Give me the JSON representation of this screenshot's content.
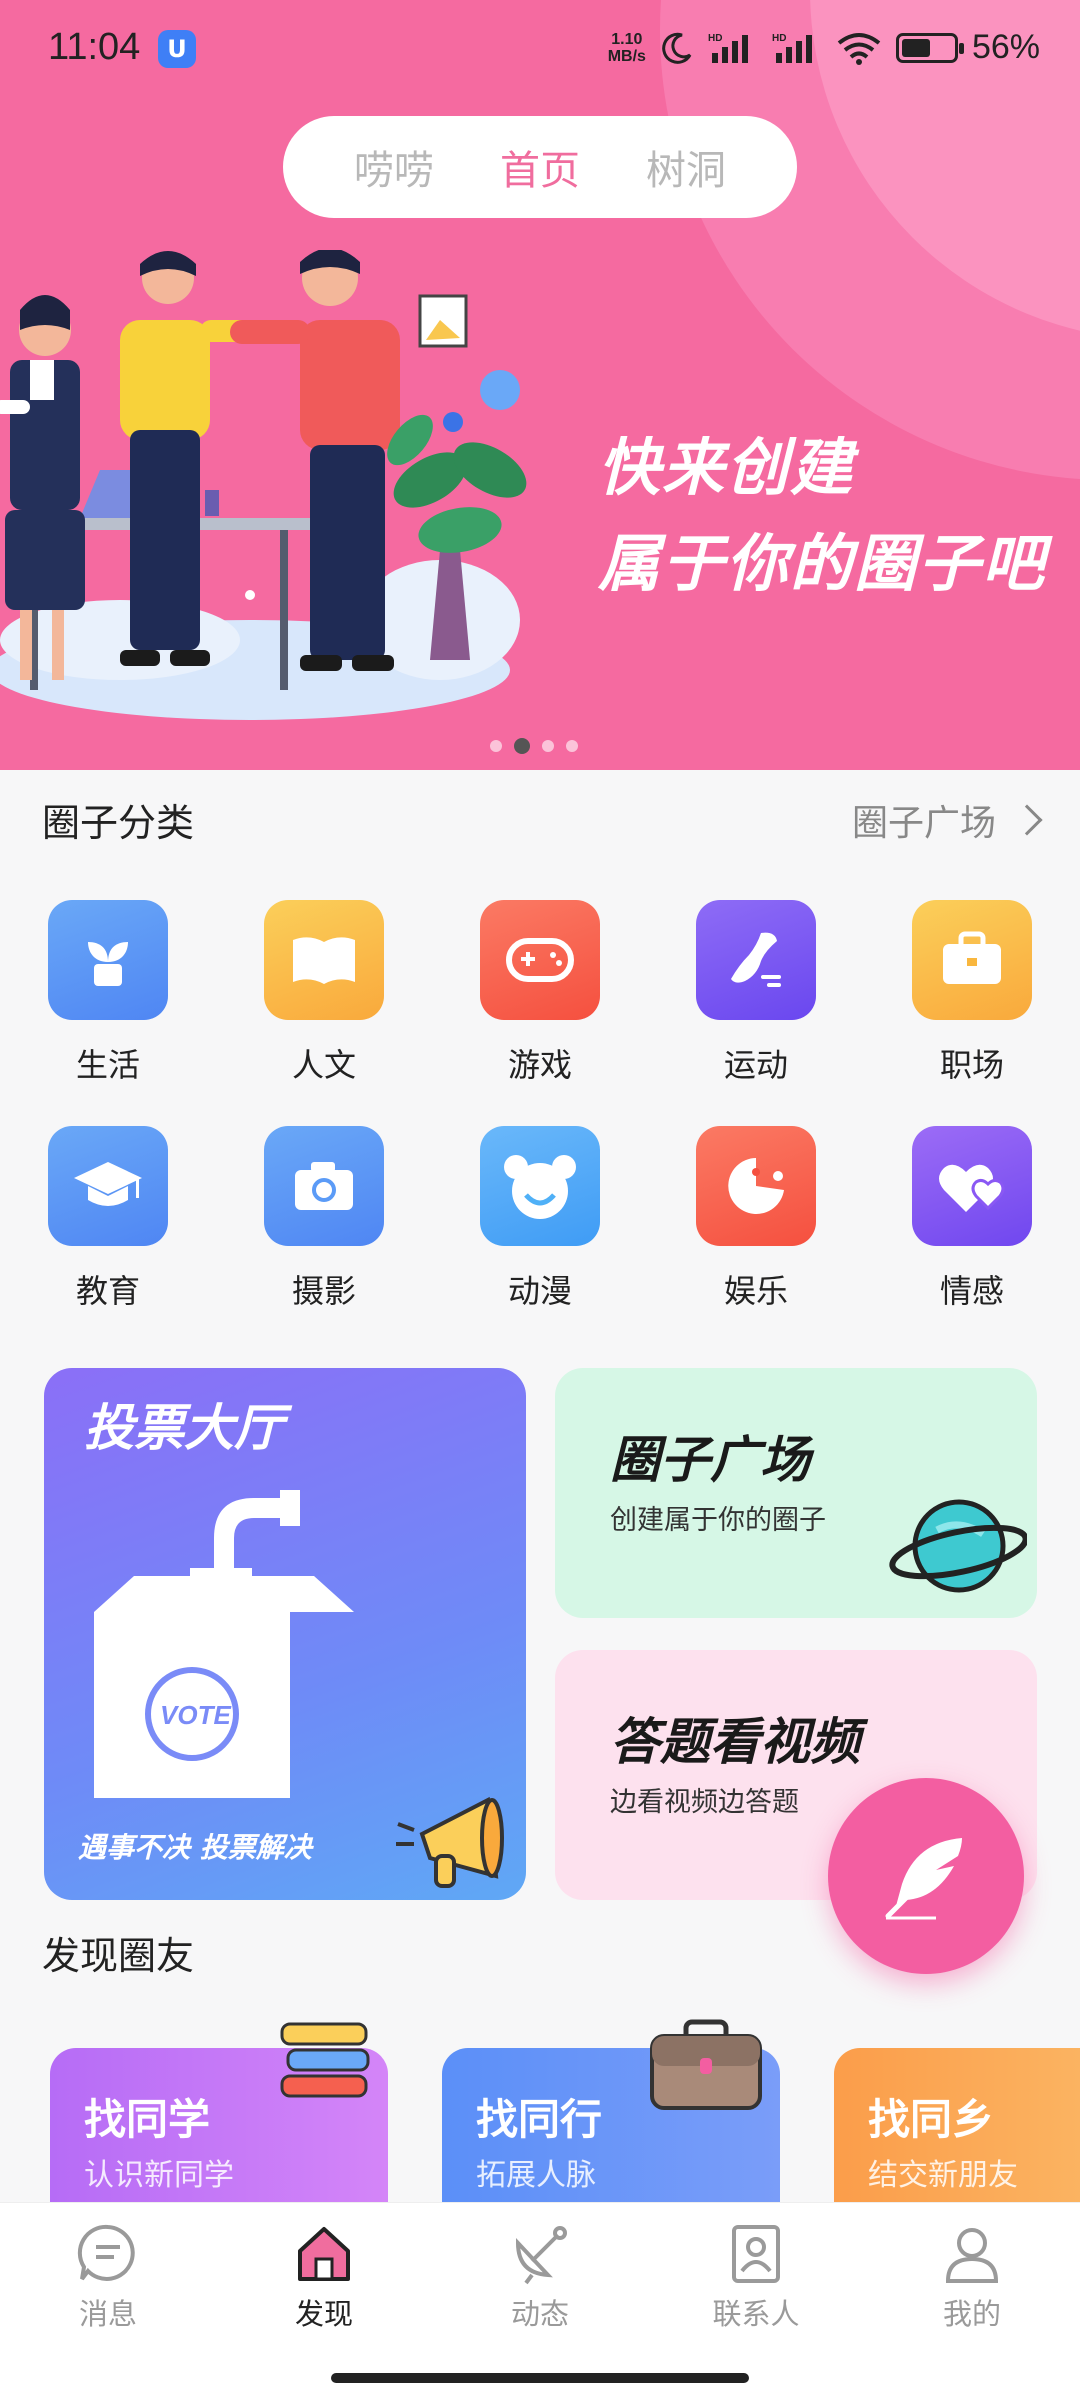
{
  "status_bar": {
    "time": "11:04",
    "app_icon": "U",
    "net_speed_value": "1.10",
    "net_speed_unit": "MB/s",
    "battery_text": "56%",
    "battery_level": 0.56
  },
  "top_tabs": [
    {
      "label": "唠唠",
      "active": false
    },
    {
      "label": "首页",
      "active": true
    },
    {
      "label": "树洞",
      "active": false
    }
  ],
  "banner": {
    "line1": "快来创建",
    "line2": "属于你的圈子吧",
    "current_slide": 2,
    "slide_count": 4
  },
  "categories": {
    "title": "圈子分类",
    "more_label": "圈子广场",
    "items": [
      {
        "label": "生活",
        "icon": "plant-icon",
        "color": "#5b9bf7"
      },
      {
        "label": "人文",
        "icon": "book-icon",
        "color": "#f9b73e"
      },
      {
        "label": "游戏",
        "icon": "gamepad-icon",
        "color": "#f9624f"
      },
      {
        "label": "运动",
        "icon": "sneaker-icon",
        "color": "#7a58f4"
      },
      {
        "label": "职场",
        "icon": "briefcase-icon",
        "color": "#f9b73e"
      },
      {
        "label": "教育",
        "icon": "graduation-cap-icon",
        "color": "#5b9bf7"
      },
      {
        "label": "摄影",
        "icon": "camera-icon",
        "color": "#5b9bf7"
      },
      {
        "label": "动漫",
        "icon": "bear-icon",
        "color": "#4fb0f7"
      },
      {
        "label": "娱乐",
        "icon": "pacman-icon",
        "color": "#f9624f"
      },
      {
        "label": "情感",
        "icon": "hearts-icon",
        "color": "#8a58f4"
      }
    ]
  },
  "cards": {
    "vote": {
      "title": "投票大厅",
      "footer": "遇事不决  投票解决",
      "badge": "VOTE"
    },
    "plaza": {
      "title": "圈子广场",
      "desc": "创建属于你的圈子"
    },
    "quiz": {
      "title": "答题看视频",
      "desc": "边看视频边答题"
    }
  },
  "friends": {
    "title": "发现圈友",
    "items": [
      {
        "title": "找同学",
        "sub": "认识新同学"
      },
      {
        "title": "找同行",
        "sub": "拓展人脉"
      },
      {
        "title": "找同乡",
        "sub": "结交新朋友"
      }
    ]
  },
  "bottom_nav": [
    {
      "label": "消息",
      "icon": "message-icon",
      "active": false
    },
    {
      "label": "发现",
      "icon": "home-icon",
      "active": true
    },
    {
      "label": "动态",
      "icon": "satellite-icon",
      "active": false
    },
    {
      "label": "联系人",
      "icon": "contacts-icon",
      "active": false
    },
    {
      "label": "我的",
      "icon": "profile-icon",
      "active": false
    }
  ],
  "colors": {
    "accent_pink": "#f06d9e",
    "hero_bg": "#f56aa0",
    "fab": "#f35ea1"
  }
}
